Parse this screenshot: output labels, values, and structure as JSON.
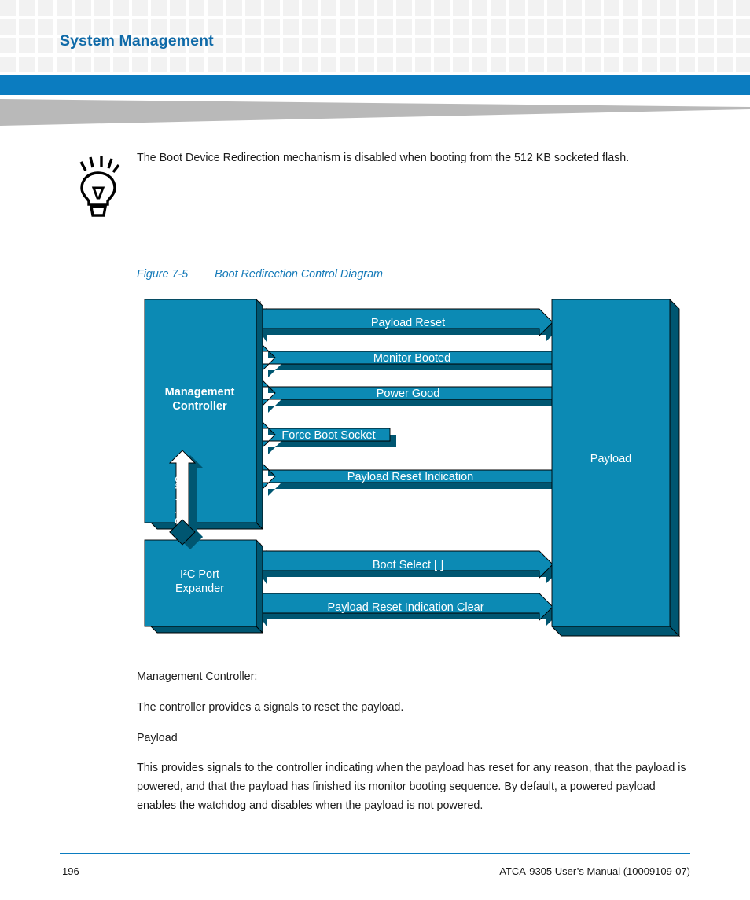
{
  "header": {
    "title": "System Management",
    "accent_blue": "#0b7cc0",
    "title_color": "#0f6aa8",
    "swoosh_gray": "#b9b9b9"
  },
  "tip": {
    "icon": "lightbulb-icon",
    "text": "The Boot Device Redirection mechanism is disabled when booting from the 512 KB socketed flash."
  },
  "figure": {
    "number": "Figure 7-5",
    "title": "Boot Redirection Control Diagram",
    "caption_color": "#1379b8"
  },
  "diagram": {
    "fill_color": "#0c8ab4",
    "shade_color": "#005671",
    "text_color": "#ffffff",
    "blocks": [
      {
        "id": "management-controller",
        "label": "Management\nController",
        "line1": "Management",
        "line2": "Controller"
      },
      {
        "id": "i2c-port-expander",
        "label": "I2C Port Expander",
        "line1": "I²C Port",
        "line2": "Expander"
      },
      {
        "id": "payload",
        "label": "Payload",
        "line1": "Payload",
        "line2": ""
      }
    ],
    "vertical_link": {
      "label": "Private I²C",
      "direction": "bidirectional",
      "from": "management-controller",
      "to": "i2c-port-expander"
    },
    "signals": [
      {
        "label": "Payload Reset",
        "direction": "right",
        "from": "management-controller",
        "to": "payload",
        "short": false
      },
      {
        "label": "Monitor Booted",
        "direction": "left",
        "from": "payload",
        "to": "management-controller",
        "short": false
      },
      {
        "label": "Power Good",
        "direction": "left",
        "from": "payload",
        "to": "management-controller",
        "short": false
      },
      {
        "label": "Force Boot Socket",
        "direction": "left",
        "from": "payload",
        "to": "management-controller",
        "short": true
      },
      {
        "label": "Payload Reset Indication",
        "direction": "left",
        "from": "payload",
        "to": "management-controller",
        "short": false
      },
      {
        "label": "Boot Select [ ]",
        "direction": "right",
        "from": "i2c-port-expander",
        "to": "payload",
        "short": false
      },
      {
        "label": "Payload Reset Indication Clear",
        "direction": "right",
        "from": "i2c-port-expander",
        "to": "payload",
        "short": false
      }
    ]
  },
  "body": {
    "mc_heading": "Management Controller:",
    "mc_text": "The controller provides a signals to reset the payload.",
    "payload_heading": "Payload",
    "payload_text": "This provides signals to the controller indicating when the payload has reset for any reason, that the payload is powered, and that the payload has finished its monitor booting sequence. By default, a powered payload enables the watchdog and disables when the payload is not powered."
  },
  "footer": {
    "page_number": "196",
    "manual_title": "ATCA-9305 User’s Manual (10009109-07)"
  }
}
